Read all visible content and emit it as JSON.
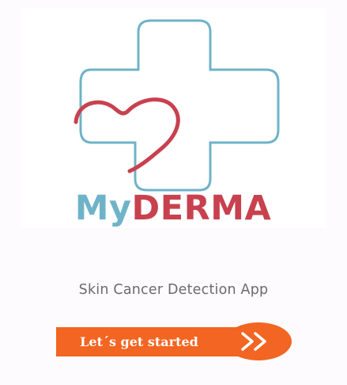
{
  "logo": {
    "brand_prefix": "My",
    "brand_suffix": "DERMA",
    "icon": "medical-cross-heart-icon",
    "colors": {
      "cross": "#6fb3c8",
      "heart": "#c8414e"
    }
  },
  "tagline": "Skin Cancer Detection App",
  "cta": {
    "label": "Let´s get started",
    "icon": "double-chevron-right-icon",
    "color": "#f26522"
  }
}
